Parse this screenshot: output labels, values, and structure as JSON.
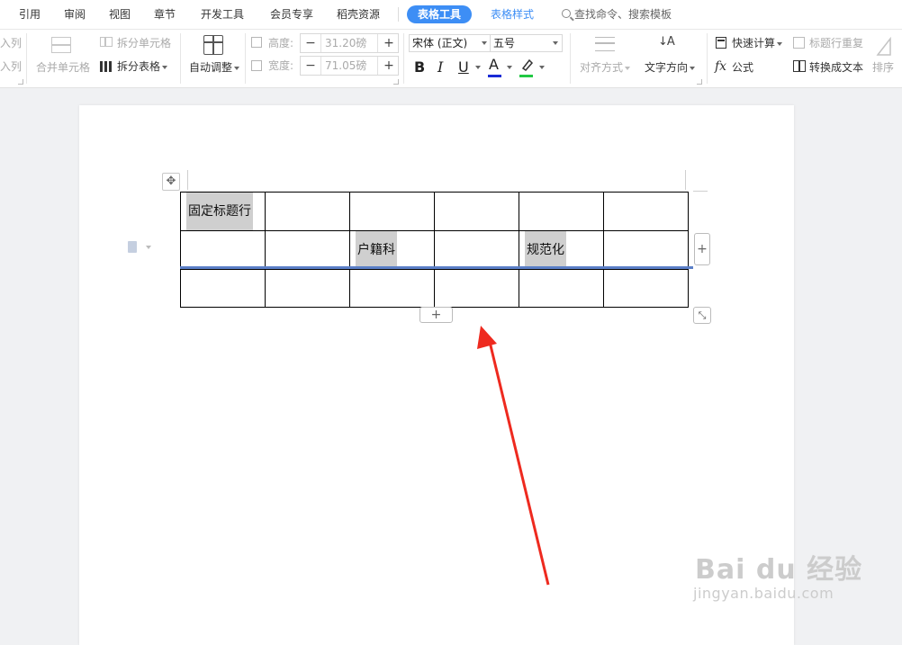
{
  "menu": {
    "items": [
      {
        "label": "引用"
      },
      {
        "label": "审阅"
      },
      {
        "label": "视图"
      },
      {
        "label": "章节"
      },
      {
        "label": "开发工具"
      },
      {
        "label": "会员专享"
      },
      {
        "label": "稻壳资源"
      }
    ],
    "active_tab": "表格工具",
    "style_tab": "表格样式",
    "search": "查找命令、搜索模板"
  },
  "ribbon": {
    "insert_col_top": "入列",
    "insert_col_bottom": "入列",
    "merge_cells": "合并单元格",
    "split_cells": "拆分单元格",
    "split_table": "拆分表格",
    "auto_fit": "自动调整",
    "height_label": "高度:",
    "height_value": "31.20磅",
    "width_label": "宽度:",
    "width_value": "71.05磅",
    "font_name": "宋体 (正文)",
    "font_size": "五号",
    "bold": "B",
    "italic": "I",
    "underline": "U",
    "font_color": "A",
    "align": "对齐方式",
    "text_direction": "文字方向",
    "text_direction_glyph": "↓A",
    "quick_calc": "快速计算",
    "formula": "公式",
    "formula_glyph": "fx",
    "repeat_header": "标题行重复",
    "convert_to_text": "转换成文本",
    "sort": "排序",
    "minus": "−",
    "plus": "+",
    "accent_color": "#3d8ef5",
    "font_color_bar": "#1a2bd6",
    "highlight_color_bar": "#22c943"
  },
  "table": {
    "rows": [
      [
        "固定标题行",
        "",
        "",
        "",
        "",
        ""
      ],
      [
        "",
        "",
        "户籍科",
        "",
        "规范化",
        ""
      ],
      [
        "",
        "",
        "",
        "",
        "",
        ""
      ]
    ]
  },
  "controls": {
    "move_handle": "✥",
    "add_column": "+",
    "add_row": "+",
    "resize": "⤡"
  },
  "watermark": {
    "text": "Bai du 经验",
    "sub": "jingyan.baidu.com"
  }
}
